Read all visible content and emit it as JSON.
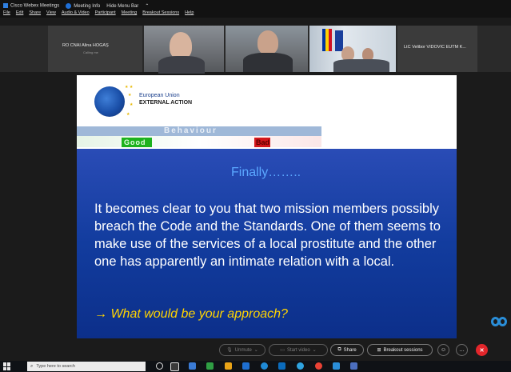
{
  "window": {
    "title_items": [
      "Cisco Webex Meetings",
      "Meeting Info",
      "Hide Menu Bar"
    ],
    "menu": [
      "File",
      "Edit",
      "Share",
      "View",
      "Audio & Video",
      "Participant",
      "Meeting",
      "Breakout Sessions",
      "Help"
    ]
  },
  "video_tiles": [
    {
      "name": "RO CNAI Alina HOGAȘ",
      "sub": "Calling me"
    },
    {
      "name": ""
    },
    {
      "name": ""
    },
    {
      "name": ""
    },
    {
      "name": "LtC Velibor VIDOVIC EUTM K..."
    }
  ],
  "slide": {
    "logo_line1": "European Union",
    "logo_line2": "EXTERNAL ACTION",
    "behaviour_label": "Behaviour",
    "good_label": "Good",
    "bad_label": "Bad",
    "heading": "Finally……..",
    "body": "It becomes clear to you that two mission members possibly breach the Code and the Standards. One of them seems to make use of the services of a local prostitute and the other one has apparently an intimate relation with a local.",
    "question": "→ What would be your approach?"
  },
  "controls": {
    "unmute": "Unmute",
    "start_video": "Start video",
    "share": "Share",
    "breakout": "Breakout sessions",
    "end_call_icon": "x-icon"
  },
  "taskbar": {
    "search_placeholder": "Type here to search"
  },
  "colors": {
    "slide_blue": "#123c9e",
    "heading_blue": "#5aa7ff",
    "question_yellow": "#ffd400",
    "good_green": "#1db21d",
    "bad_red": "#d4161b",
    "end_call_red": "#e3262b"
  }
}
